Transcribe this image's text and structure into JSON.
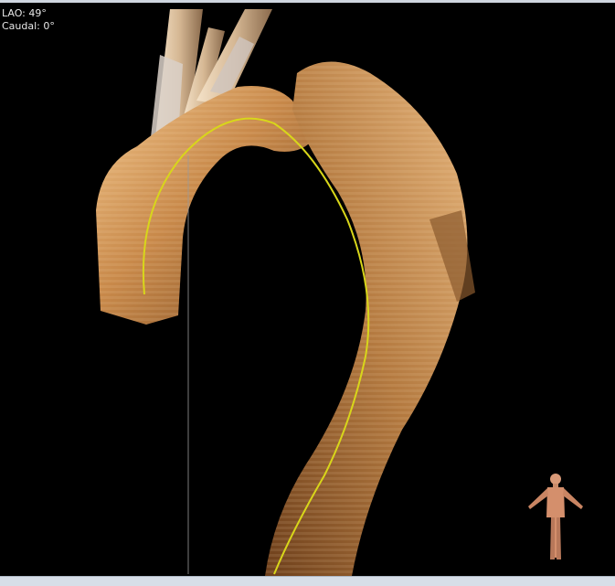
{
  "overlay": {
    "angle_line1": "LAO: 49°",
    "angle_line2": "Caudal: 0°"
  },
  "render": {
    "structure_icon": "aortic-arch-3d-icon",
    "orientation_icon": "human-figure-orientation-icon",
    "centerline_color": "#d8d61a",
    "tissue_color": "#c8894a",
    "background_color": "#000000"
  }
}
